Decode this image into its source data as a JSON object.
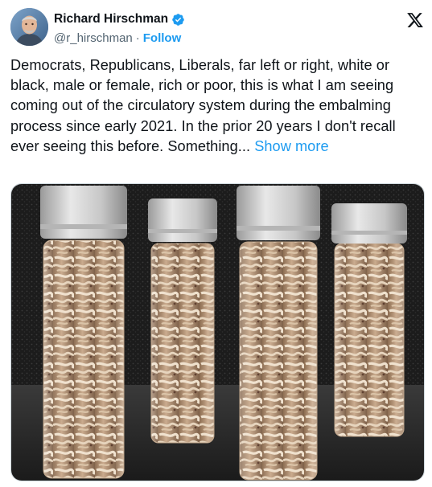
{
  "author": {
    "display_name": "Richard Hirschman",
    "handle": "@r_hirschman",
    "separator": "·",
    "follow_label": "Follow",
    "verified": true
  },
  "brand": {
    "logo": "x-logo-icon"
  },
  "tweet": {
    "text": "Democrats, Republicans, Liberals, far left or right, white or black, male or female, rich or poor, this is what I am seeing coming out of the circulatory system during the embalming process since early 2021. In the prior 20 years I don't recall ever seeing this before. Something...",
    "show_more_label": "Show more"
  },
  "colors": {
    "accent": "#1d9bf0",
    "text": "#0f1419",
    "secondary": "#536471"
  }
}
